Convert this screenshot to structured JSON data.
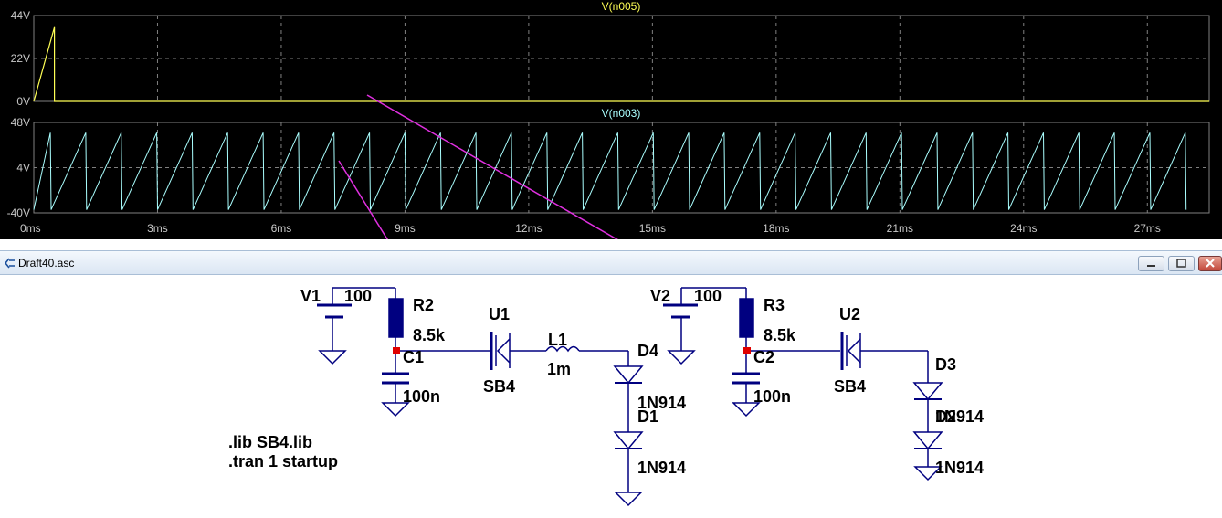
{
  "window": {
    "title": "Draft40.asc"
  },
  "plot": {
    "panes": [
      {
        "trace": "V(n005)",
        "trace_color": "#ffff55",
        "y_ticks": [
          "44V",
          "22V",
          "0V"
        ]
      },
      {
        "trace": "V(n003)",
        "trace_color": "#aaffff",
        "y_ticks": [
          "48V",
          "4V",
          "-40V"
        ]
      }
    ],
    "x_ticks": [
      "0ms",
      "3ms",
      "6ms",
      "9ms",
      "12ms",
      "15ms",
      "18ms",
      "21ms",
      "24ms",
      "27ms"
    ],
    "grid_color": "#808080",
    "cursor_color": "#e030e0"
  },
  "chart_data": [
    {
      "type": "line",
      "title": "V(n005)",
      "x_unit": "ms",
      "xlim": [
        0,
        28.5
      ],
      "ylim": [
        0,
        44
      ],
      "y_unit": "V",
      "series": [
        {
          "name": "V(n005)",
          "color": "#ffff55",
          "x": [
            0,
            0.5,
            0.5,
            28.5
          ],
          "y": [
            0,
            38,
            0,
            0
          ]
        }
      ]
    },
    {
      "type": "line",
      "title": "V(n003)",
      "x_unit": "ms",
      "xlim": [
        0,
        28.5
      ],
      "ylim": [
        -40,
        48
      ],
      "y_unit": "V",
      "series": [
        {
          "name": "V(n003)",
          "color": "#aaffff",
          "waveform": "sawtooth",
          "period_ms": 0.86,
          "high": 38,
          "low": -37,
          "start_ms": 0.4
        }
      ]
    }
  ],
  "schematic": {
    "directives": [
      ".lib SB4.lib",
      ".tran 1 startup"
    ],
    "components": {
      "V1": {
        "name": "V1",
        "value": "100"
      },
      "V2": {
        "name": "V2",
        "value": "100"
      },
      "R2": {
        "name": "R2",
        "value": "8.5k"
      },
      "R3": {
        "name": "R3",
        "value": "8.5k"
      },
      "C1": {
        "name": "C1",
        "value": "100n"
      },
      "C2": {
        "name": "C2",
        "value": "100n"
      },
      "U1": {
        "name": "U1",
        "value": "SB4"
      },
      "U2": {
        "name": "U2",
        "value": "SB4"
      },
      "L1": {
        "name": "L1",
        "value": "1m"
      },
      "D4": {
        "name": "D4",
        "value": "1N914"
      },
      "D1": {
        "name": "D1",
        "value": "1N914"
      },
      "D3": {
        "name": "D3",
        "value": "1N914"
      },
      "D2": {
        "name": "D2",
        "value": "1N914"
      }
    },
    "wire_color": "#000080",
    "part_color": "#000080"
  }
}
